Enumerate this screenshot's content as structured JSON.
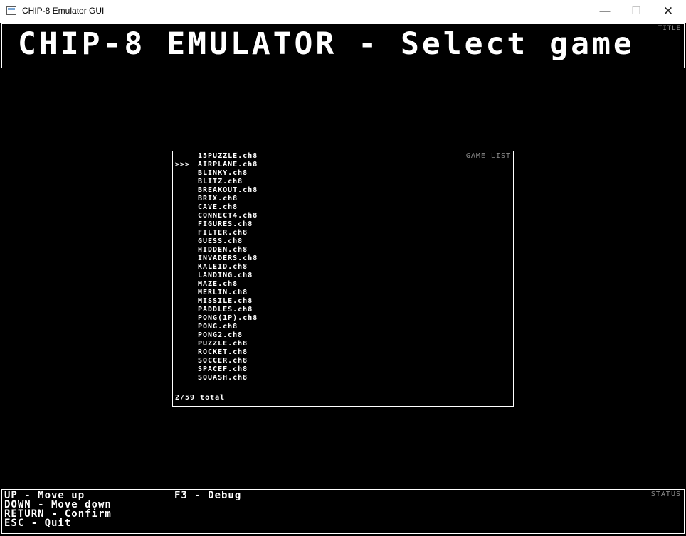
{
  "window": {
    "title": "CHIP-8 Emulator GUI",
    "min_glyph": "—",
    "max_glyph": "☐",
    "close_glyph": "✕"
  },
  "title_panel": {
    "tag": "TITLE",
    "heading": "CHIP-8 EMULATOR - Select game"
  },
  "game_list": {
    "tag": "GAME LIST",
    "selected_index": 1,
    "cursor": ">>>",
    "items": [
      "15PUZZLE.ch8",
      "AIRPLANE.ch8",
      "BLINKY.ch8",
      "BLITZ.ch8",
      "BREAKOUT.ch8",
      "BRIX.ch8",
      "CAVE.ch8",
      "CONNECT4.ch8",
      "FIGURES.ch8",
      "FILTER.ch8",
      "GUESS.ch8",
      "HIDDEN.ch8",
      "INVADERS.ch8",
      "KALEID.ch8",
      "LANDING.ch8",
      "MAZE.ch8",
      "MERLIN.ch8",
      "MISSILE.ch8",
      "PADDLES.ch8",
      "PONG(1P).ch8",
      "PONG.ch8",
      "PONG2.ch8",
      "PUZZLE.ch8",
      "ROCKET.ch8",
      "SOCCER.ch8",
      "SPACEF.ch8",
      "SQUASH.ch8"
    ],
    "count_text": "2/59 total"
  },
  "status_panel": {
    "tag": "STATUS",
    "help_left": [
      "UP - Move up",
      "DOWN - Move down",
      "RETURN - Confirm",
      "ESC - Quit"
    ],
    "help_right": [
      "F3 - Debug"
    ]
  },
  "colors": {
    "background": "#000000",
    "foreground": "#ffffff",
    "tag_gray": "#8a8a8a"
  }
}
